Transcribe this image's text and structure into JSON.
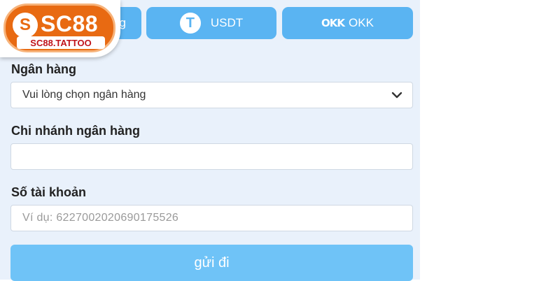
{
  "tabs": {
    "bank_partial_label": "g",
    "usdt_label": "USDT",
    "usdt_icon": "T",
    "okk_icon": "OKK",
    "okk_label": "OKK"
  },
  "logo": {
    "mark": "S",
    "name": "SC88",
    "subtitle": "SC88.TATTOO"
  },
  "form": {
    "bank_label": "Ngân hàng",
    "bank_select_value": "Vui lòng chọn ngân hàng",
    "branch_label": "Chi nhánh ngân hàng",
    "branch_value": "",
    "account_label": "Số tài khoản",
    "account_placeholder": "Ví dụ:  6227002020690175526",
    "submit_label": "gửi đi"
  },
  "colors": {
    "tab_bg": "#5ab4f2",
    "submit_bg": "#6fc3f7",
    "panel_bg": "#e9f1fb",
    "logo_orange": "#e86a12"
  }
}
